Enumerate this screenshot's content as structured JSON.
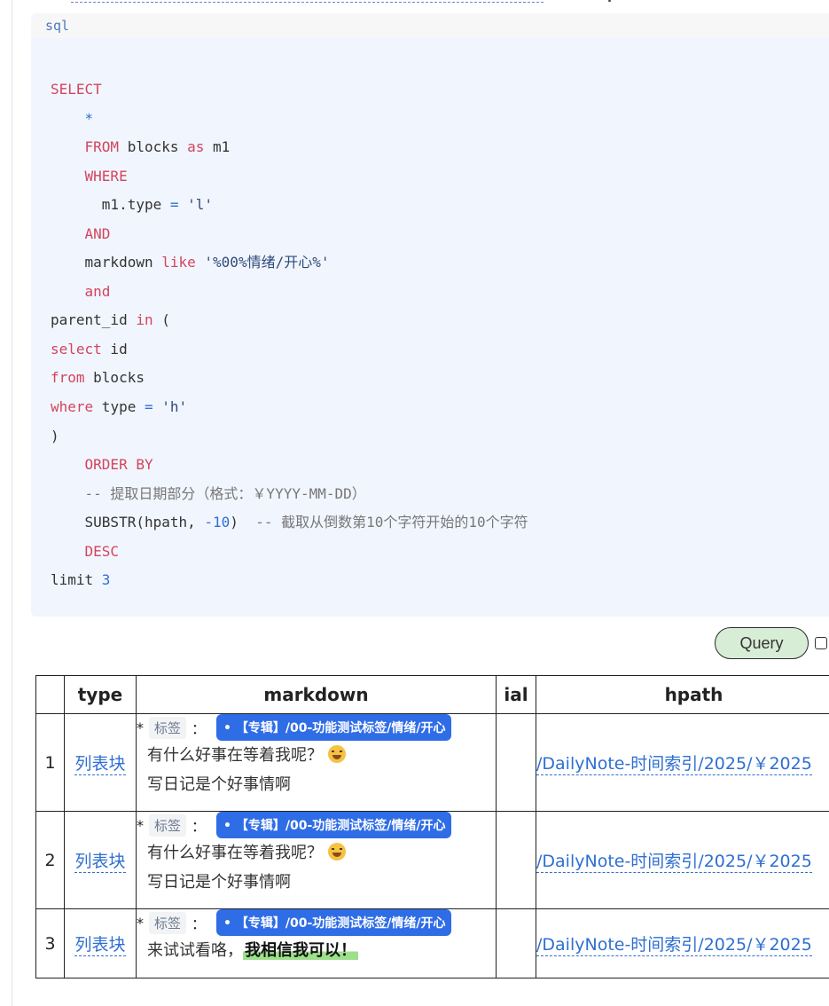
{
  "code": {
    "lang": "sql",
    "lines": [
      [
        [
          "kw",
          "SELECT"
        ]
      ],
      [
        [
          "plain",
          "    "
        ],
        [
          "num",
          "*"
        ]
      ],
      [
        [
          "plain",
          "    "
        ],
        [
          "kw",
          "FROM"
        ],
        [
          "plain",
          " blocks "
        ],
        [
          "kw",
          "as"
        ],
        [
          "plain",
          " m1"
        ]
      ],
      [
        [
          "plain",
          "    "
        ],
        [
          "kw",
          "WHERE"
        ]
      ],
      [
        [
          "plain",
          "      m1.type "
        ],
        [
          "num",
          "="
        ],
        [
          "plain",
          " "
        ],
        [
          "str",
          "'l'"
        ]
      ],
      [
        [
          "plain",
          "    "
        ],
        [
          "kw",
          "AND"
        ]
      ],
      [
        [
          "plain",
          "    markdown "
        ],
        [
          "kw",
          "like"
        ],
        [
          "plain",
          " "
        ],
        [
          "str",
          "'%00%情绪/开心%'"
        ]
      ],
      [
        [
          "plain",
          "    "
        ],
        [
          "kw",
          "and"
        ]
      ],
      [
        [
          "plain",
          "parent_id "
        ],
        [
          "kw",
          "in"
        ],
        [
          "plain",
          " ("
        ]
      ],
      [
        [
          "kw",
          "select"
        ],
        [
          "plain",
          " id"
        ]
      ],
      [
        [
          "kw",
          "from"
        ],
        [
          "plain",
          " blocks"
        ]
      ],
      [
        [
          "kw",
          "where"
        ],
        [
          "plain",
          " type "
        ],
        [
          "num",
          "="
        ],
        [
          "plain",
          " "
        ],
        [
          "str",
          "'h'"
        ]
      ],
      [
        [
          "plain",
          ")"
        ]
      ],
      [
        [
          "plain",
          "    "
        ],
        [
          "kw",
          "ORDER BY"
        ]
      ],
      [
        [
          "plain",
          "    "
        ],
        [
          "cm",
          "-- 提取日期部分（格式：￥YYYY-MM-DD）"
        ]
      ],
      [
        [
          "plain",
          "    SUBSTR(hpath, "
        ],
        [
          "num",
          "-10"
        ],
        [
          "plain",
          ")  "
        ],
        [
          "cm",
          "-- 截取从倒数第10个字符开始的10个字符"
        ]
      ],
      [
        [
          "plain",
          "    "
        ],
        [
          "kw",
          "DESC"
        ]
      ],
      [
        [
          "plain",
          "limit "
        ],
        [
          "num",
          "3"
        ]
      ]
    ]
  },
  "query_button": "Query",
  "table": {
    "headers": [
      "",
      "type",
      "markdown",
      "ial",
      "hpath"
    ],
    "rows": [
      {
        "index": "1",
        "type": "列表块",
        "star": "*",
        "tag_label": "标签",
        "colon": "：",
        "tag": "• 【专辑】/00-功能测试标签/情绪/开心",
        "line2": "有什么好事在等着我呢？",
        "line2_emoji": true,
        "line3": "写日记是个好事情啊",
        "ial": "",
        "hpath": "/DailyNote-时间索引/2025/￥2025"
      },
      {
        "index": "2",
        "type": "列表块",
        "star": "*",
        "tag_label": "标签",
        "colon": "：",
        "tag": "• 【专辑】/00-功能测试标签/情绪/开心",
        "line2": "有什么好事在等着我呢？",
        "line2_emoji": true,
        "line3": "写日记是个好事情啊",
        "ial": "",
        "hpath": "/DailyNote-时间索引/2025/￥2025"
      },
      {
        "index": "3",
        "type": "列表块",
        "star": "*",
        "tag_label": "标签",
        "colon": "：",
        "tag": "• 【专辑】/00-功能测试标签/情绪/开心",
        "line2": "来试试看咯，",
        "line2_highlight": "我相信我可以！",
        "ial": "",
        "hpath": "/DailyNote-时间索引/2025/￥2025"
      }
    ]
  }
}
